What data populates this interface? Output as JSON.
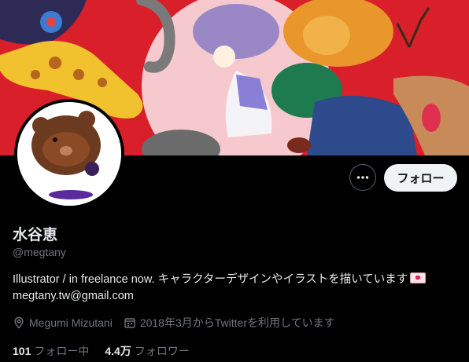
{
  "profile": {
    "name": "水谷恵",
    "handle": "@megtany",
    "bio_line1": "Illustrator / in freelance now. キャラクターデザインやイラストを描いています",
    "bio_line2": "megtany.tw@gmail.com",
    "location": "Megumi Mizutani",
    "joined": "2018年3月からTwitterを利用しています",
    "following_count": "101",
    "following_label": "フォロー中",
    "followers_count": "4.4万",
    "followers_label": "フォロワー"
  },
  "actions": {
    "follow_label": "フォロー",
    "more_icon": "more-icon"
  },
  "icons": {
    "location": "location-pin-icon",
    "calendar": "calendar-icon",
    "bio_emoji": "love-letter-icon"
  },
  "colors": {
    "background": "#000000",
    "banner_red": "#d81f2a",
    "text": "#e7e9ea",
    "muted": "#71767b",
    "follow_bg": "#eff3f4"
  }
}
